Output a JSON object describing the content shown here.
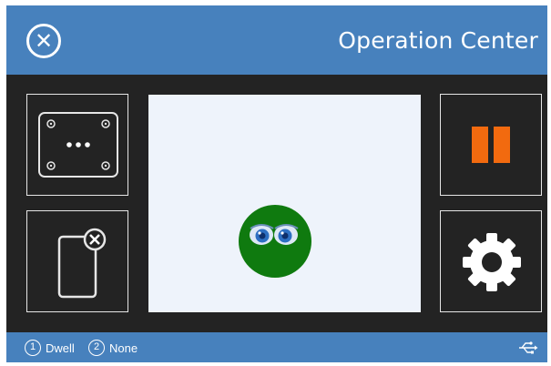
{
  "window": {
    "title": "Operation Center",
    "close_icon": "close-x-icon"
  },
  "panels": {
    "top_left": {
      "icon": "device-dots-icon"
    },
    "bottom_left": {
      "icon": "device-remove-icon"
    },
    "top_right": {
      "icon": "pause-icon"
    },
    "bottom_right": {
      "icon": "gear-icon"
    }
  },
  "stage": {
    "figure": "face-eyes-icon"
  },
  "statusbar": {
    "items": [
      {
        "number": "1",
        "label": "Dwell"
      },
      {
        "number": "2",
        "label": "None"
      }
    ],
    "connection_icon": "usb-icon"
  },
  "colors": {
    "titlebar": "#4781bd",
    "background": "#232323",
    "stage": "#eef3fb",
    "pause": "#f26a0f",
    "face": "#0f7a0f"
  }
}
